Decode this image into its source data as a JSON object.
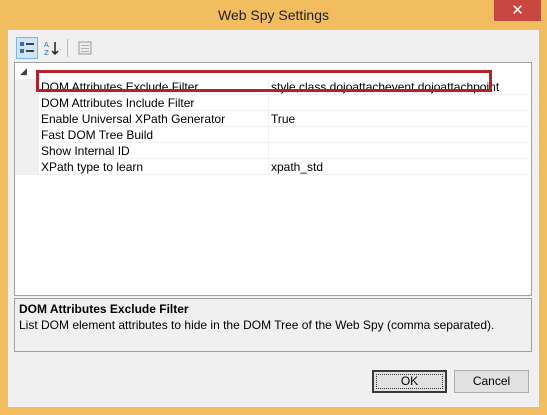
{
  "window": {
    "title": "Web Spy Settings",
    "close_label": "✕"
  },
  "toolbar": {
    "categorized_icon": "categorized-icon",
    "alphabetical_icon": "alphabetical-icon",
    "property_pages_icon": "property-pages-icon"
  },
  "grid": {
    "category_toggle": "◢",
    "properties": [
      {
        "name": "DOM Attributes Exclude Filter",
        "value": "style,class,dojoattachevent,dojoattachpoint"
      },
      {
        "name": "DOM Attributes Include Filter",
        "value": ""
      },
      {
        "name": "Enable Universal XPath Generator",
        "value": "True"
      },
      {
        "name": "Fast DOM Tree Build",
        "value": ""
      },
      {
        "name": "Show Internal ID",
        "value": ""
      },
      {
        "name": "XPath type to learn",
        "value": "xpath_std"
      }
    ]
  },
  "description": {
    "title": "DOM Attributes Exclude Filter",
    "text": "List DOM element attributes to hide in the DOM Tree of the Web Spy (comma separated)."
  },
  "buttons": {
    "ok": "OK",
    "cancel": "Cancel"
  },
  "colors": {
    "title_bar": "#f2bd5e",
    "close_button": "#c7463f",
    "highlight": "#b3212a"
  }
}
